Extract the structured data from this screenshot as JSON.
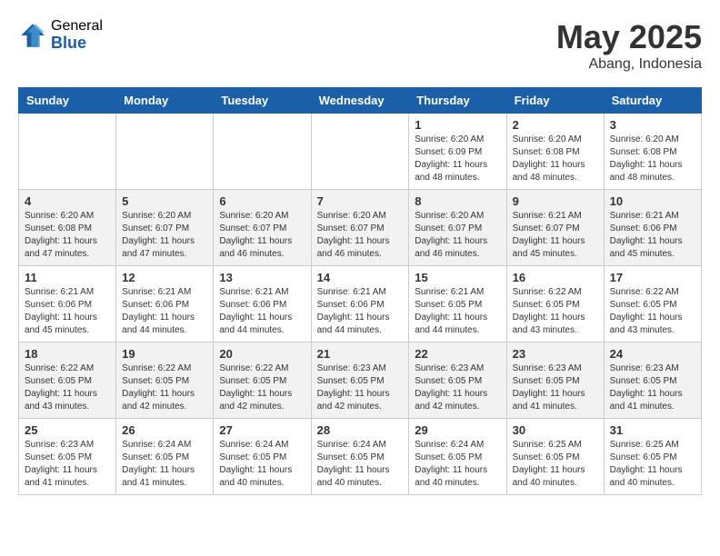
{
  "header": {
    "logo_general": "General",
    "logo_blue": "Blue",
    "month": "May 2025",
    "location": "Abang, Indonesia"
  },
  "days_of_week": [
    "Sunday",
    "Monday",
    "Tuesday",
    "Wednesday",
    "Thursday",
    "Friday",
    "Saturday"
  ],
  "weeks": [
    [
      {
        "day": "",
        "info": ""
      },
      {
        "day": "",
        "info": ""
      },
      {
        "day": "",
        "info": ""
      },
      {
        "day": "",
        "info": ""
      },
      {
        "day": "1",
        "info": "Sunrise: 6:20 AM\nSunset: 6:09 PM\nDaylight: 11 hours\nand 48 minutes."
      },
      {
        "day": "2",
        "info": "Sunrise: 6:20 AM\nSunset: 6:08 PM\nDaylight: 11 hours\nand 48 minutes."
      },
      {
        "day": "3",
        "info": "Sunrise: 6:20 AM\nSunset: 6:08 PM\nDaylight: 11 hours\nand 48 minutes."
      }
    ],
    [
      {
        "day": "4",
        "info": "Sunrise: 6:20 AM\nSunset: 6:08 PM\nDaylight: 11 hours\nand 47 minutes."
      },
      {
        "day": "5",
        "info": "Sunrise: 6:20 AM\nSunset: 6:07 PM\nDaylight: 11 hours\nand 47 minutes."
      },
      {
        "day": "6",
        "info": "Sunrise: 6:20 AM\nSunset: 6:07 PM\nDaylight: 11 hours\nand 46 minutes."
      },
      {
        "day": "7",
        "info": "Sunrise: 6:20 AM\nSunset: 6:07 PM\nDaylight: 11 hours\nand 46 minutes."
      },
      {
        "day": "8",
        "info": "Sunrise: 6:20 AM\nSunset: 6:07 PM\nDaylight: 11 hours\nand 46 minutes."
      },
      {
        "day": "9",
        "info": "Sunrise: 6:21 AM\nSunset: 6:07 PM\nDaylight: 11 hours\nand 45 minutes."
      },
      {
        "day": "10",
        "info": "Sunrise: 6:21 AM\nSunset: 6:06 PM\nDaylight: 11 hours\nand 45 minutes."
      }
    ],
    [
      {
        "day": "11",
        "info": "Sunrise: 6:21 AM\nSunset: 6:06 PM\nDaylight: 11 hours\nand 45 minutes."
      },
      {
        "day": "12",
        "info": "Sunrise: 6:21 AM\nSunset: 6:06 PM\nDaylight: 11 hours\nand 44 minutes."
      },
      {
        "day": "13",
        "info": "Sunrise: 6:21 AM\nSunset: 6:06 PM\nDaylight: 11 hours\nand 44 minutes."
      },
      {
        "day": "14",
        "info": "Sunrise: 6:21 AM\nSunset: 6:06 PM\nDaylight: 11 hours\nand 44 minutes."
      },
      {
        "day": "15",
        "info": "Sunrise: 6:21 AM\nSunset: 6:05 PM\nDaylight: 11 hours\nand 44 minutes."
      },
      {
        "day": "16",
        "info": "Sunrise: 6:22 AM\nSunset: 6:05 PM\nDaylight: 11 hours\nand 43 minutes."
      },
      {
        "day": "17",
        "info": "Sunrise: 6:22 AM\nSunset: 6:05 PM\nDaylight: 11 hours\nand 43 minutes."
      }
    ],
    [
      {
        "day": "18",
        "info": "Sunrise: 6:22 AM\nSunset: 6:05 PM\nDaylight: 11 hours\nand 43 minutes."
      },
      {
        "day": "19",
        "info": "Sunrise: 6:22 AM\nSunset: 6:05 PM\nDaylight: 11 hours\nand 42 minutes."
      },
      {
        "day": "20",
        "info": "Sunrise: 6:22 AM\nSunset: 6:05 PM\nDaylight: 11 hours\nand 42 minutes."
      },
      {
        "day": "21",
        "info": "Sunrise: 6:23 AM\nSunset: 6:05 PM\nDaylight: 11 hours\nand 42 minutes."
      },
      {
        "day": "22",
        "info": "Sunrise: 6:23 AM\nSunset: 6:05 PM\nDaylight: 11 hours\nand 42 minutes."
      },
      {
        "day": "23",
        "info": "Sunrise: 6:23 AM\nSunset: 6:05 PM\nDaylight: 11 hours\nand 41 minutes."
      },
      {
        "day": "24",
        "info": "Sunrise: 6:23 AM\nSunset: 6:05 PM\nDaylight: 11 hours\nand 41 minutes."
      }
    ],
    [
      {
        "day": "25",
        "info": "Sunrise: 6:23 AM\nSunset: 6:05 PM\nDaylight: 11 hours\nand 41 minutes."
      },
      {
        "day": "26",
        "info": "Sunrise: 6:24 AM\nSunset: 6:05 PM\nDaylight: 11 hours\nand 41 minutes."
      },
      {
        "day": "27",
        "info": "Sunrise: 6:24 AM\nSunset: 6:05 PM\nDaylight: 11 hours\nand 40 minutes."
      },
      {
        "day": "28",
        "info": "Sunrise: 6:24 AM\nSunset: 6:05 PM\nDaylight: 11 hours\nand 40 minutes."
      },
      {
        "day": "29",
        "info": "Sunrise: 6:24 AM\nSunset: 6:05 PM\nDaylight: 11 hours\nand 40 minutes."
      },
      {
        "day": "30",
        "info": "Sunrise: 6:25 AM\nSunset: 6:05 PM\nDaylight: 11 hours\nand 40 minutes."
      },
      {
        "day": "31",
        "info": "Sunrise: 6:25 AM\nSunset: 6:05 PM\nDaylight: 11 hours\nand 40 minutes."
      }
    ]
  ]
}
